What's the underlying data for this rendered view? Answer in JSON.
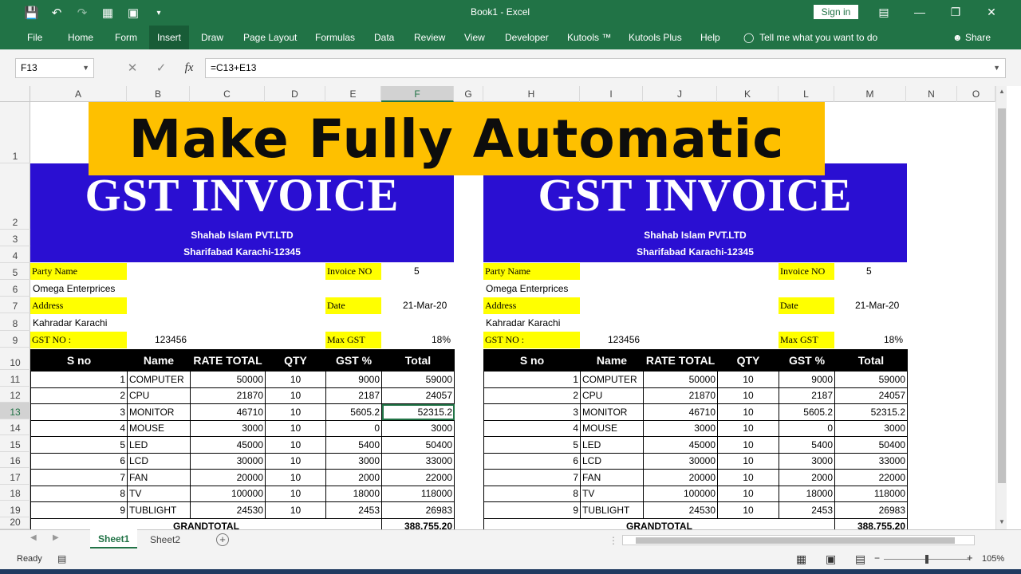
{
  "window": {
    "title": "Book1  -  Excel",
    "signin_label": "Sign in",
    "share_label": "Share"
  },
  "ribbon_tabs": [
    "File",
    "Home",
    "Form",
    "Insert",
    "Draw",
    "Page Layout",
    "Formulas",
    "Data",
    "Review",
    "View",
    "Developer",
    "Kutools ™",
    "Kutools Plus",
    "Help"
  ],
  "tell_me": "Tell me what you want to do",
  "formula_bar": {
    "name_box": "F13",
    "formula": "=C13+E13",
    "fx": "fx"
  },
  "columns": [
    "A",
    "B",
    "C",
    "D",
    "E",
    "F",
    "G",
    "H",
    "I",
    "J",
    "K",
    "L",
    "M",
    "N",
    "O"
  ],
  "rows": [
    "1",
    "2",
    "3",
    "4",
    "5",
    "6",
    "7",
    "8",
    "9",
    "10",
    "11",
    "12",
    "13",
    "14",
    "15",
    "16",
    "17",
    "18",
    "19",
    "20"
  ],
  "banner": "Make Fully Automatic",
  "invoice": {
    "title": "GST INVOICE",
    "company": "Shahab Islam PVT.LTD",
    "company_address": "Sharifabad Karachi-12345",
    "party_name_label": "Party Name",
    "party_name": "Omega Enterprices",
    "address_label": "Address",
    "address": "Kahradar Karachi",
    "gst_no_label": "GST NO :",
    "gst_no": "123456",
    "invoice_no_label": "Invoice NO",
    "invoice_no": "5",
    "date_label": "Date",
    "date": "21-Mar-20",
    "max_gst_label": "Max GST",
    "max_gst": "18%",
    "headers": [
      "S no",
      "Name",
      "RATE TOTAL",
      "QTY",
      "GST %",
      "Total"
    ],
    "items": [
      {
        "sno": "1",
        "name": "COMPUTER",
        "rate": "50000",
        "qty": "10",
        "gst": "9000",
        "total": "59000"
      },
      {
        "sno": "2",
        "name": "CPU",
        "rate": "21870",
        "qty": "10",
        "gst": "2187",
        "total": "24057"
      },
      {
        "sno": "3",
        "name": "MONITOR",
        "rate": "46710",
        "qty": "10",
        "gst": "5605.2",
        "total": "52315.2"
      },
      {
        "sno": "4",
        "name": "MOUSE",
        "rate": "3000",
        "qty": "10",
        "gst": "0",
        "total": "3000"
      },
      {
        "sno": "5",
        "name": "LED",
        "rate": "45000",
        "qty": "10",
        "gst": "5400",
        "total": "50400"
      },
      {
        "sno": "6",
        "name": "LCD",
        "rate": "30000",
        "qty": "10",
        "gst": "3000",
        "total": "33000"
      },
      {
        "sno": "7",
        "name": "FAN",
        "rate": "20000",
        "qty": "10",
        "gst": "2000",
        "total": "22000"
      },
      {
        "sno": "8",
        "name": "TV",
        "rate": "100000",
        "qty": "10",
        "gst": "18000",
        "total": "118000"
      },
      {
        "sno": "9",
        "name": "TUBLIGHT",
        "rate": "24530",
        "qty": "10",
        "gst": "2453",
        "total": "26983"
      }
    ],
    "grandtotal_label": "GRANDTOTAL",
    "grandtotal": "388,755.20"
  },
  "sheets": [
    "Sheet1",
    "Sheet2"
  ],
  "status": {
    "ready": "Ready",
    "zoom": "105%"
  },
  "colors": {
    "excel_green": "#217346",
    "banner_yellow": "#fec000",
    "invoice_blue": "#2a0fd2",
    "label_yellow": "#ffff00"
  }
}
